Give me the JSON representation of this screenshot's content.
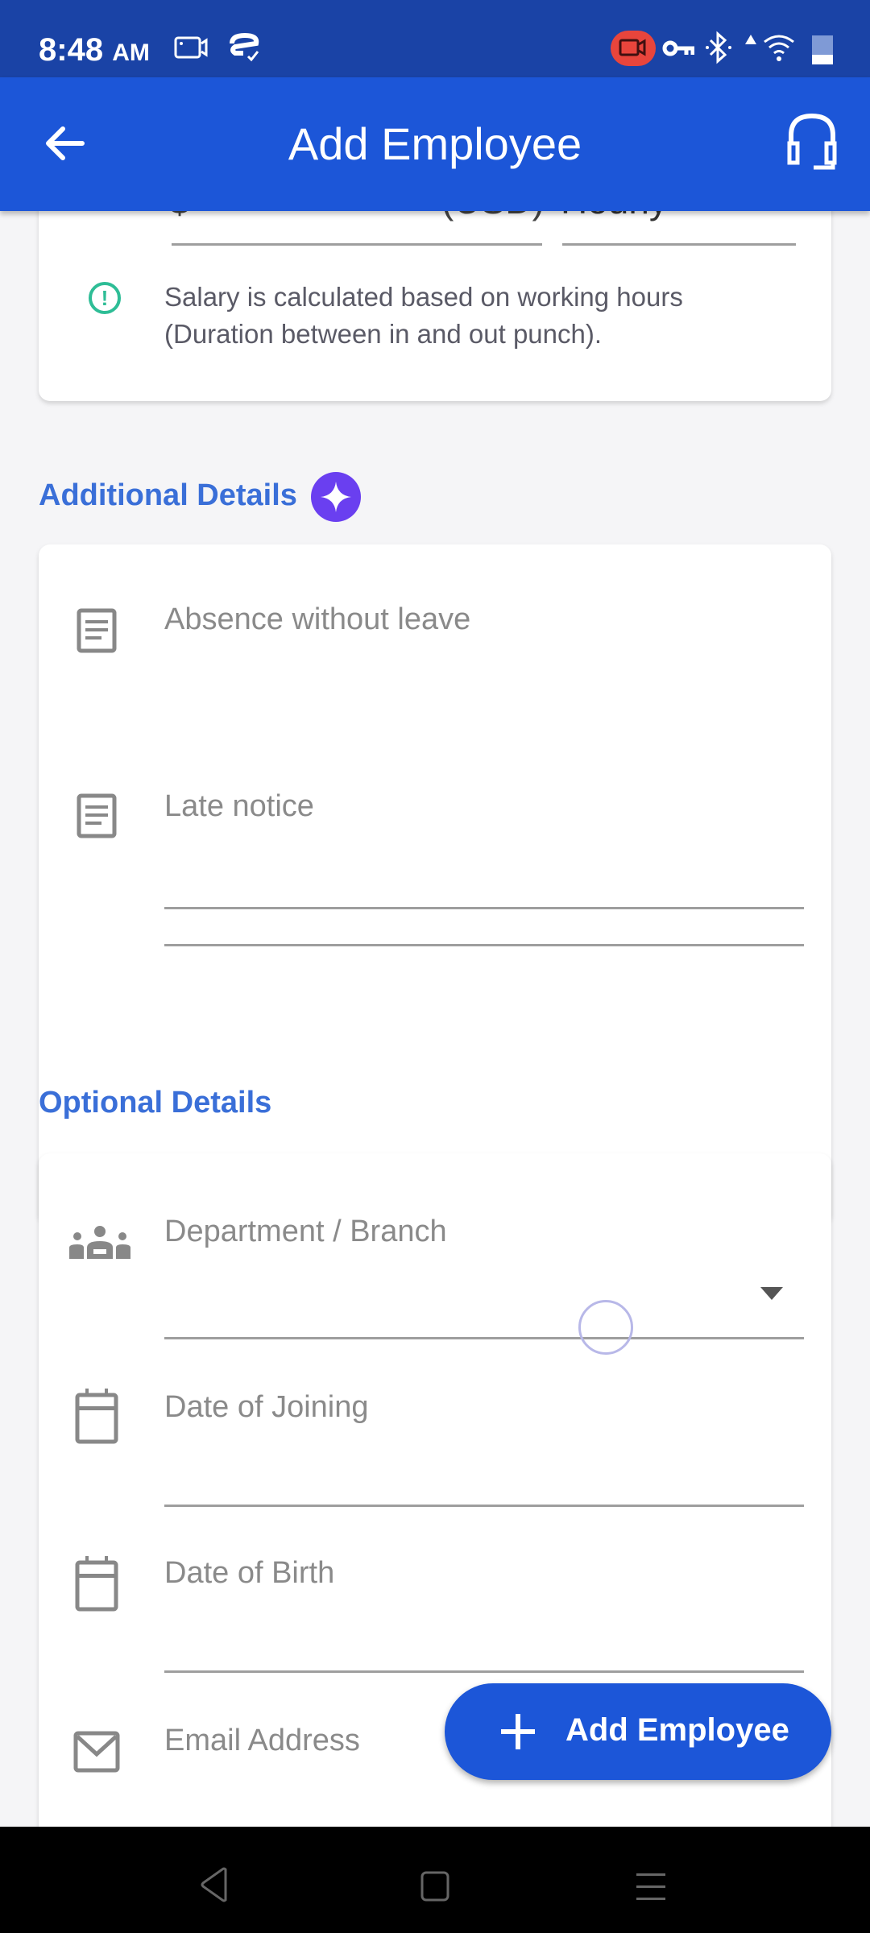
{
  "status_bar": {
    "time": "8:48",
    "ampm": "AM",
    "icons": [
      "screen-record-icon",
      "sync-check-icon",
      "recording-active-icon",
      "vpn-key-icon",
      "bluetooth-icon",
      "signal-icon",
      "wifi-icon",
      "battery-icon"
    ],
    "recording_badge_color": "#e8453c"
  },
  "app_bar": {
    "title": "Add Employee",
    "back_icon": "arrow-left-icon",
    "support_icon": "headset-icon",
    "color": "#1c56d8"
  },
  "salary_card": {
    "amount_prefix": "$",
    "currency": "(USD)",
    "frequency": "Hourly",
    "info_text_line1": "Salary is calculated based on working hours",
    "info_text_line2": "(Duration between in and out punch).",
    "info_icon_color": "#2ebd96"
  },
  "additional_details": {
    "title": "Additional Details",
    "badge_icon": "sparkle-icon",
    "badge_color": "#6a3ff0",
    "fields": [
      {
        "label": "Absence without leave",
        "icon": "notes-icon"
      },
      {
        "label": "Late notice",
        "icon": "notes-icon"
      }
    ]
  },
  "optional_details": {
    "title": "Optional Details",
    "fields": [
      {
        "label": "Department / Branch",
        "icon": "group-icon",
        "type": "dropdown"
      },
      {
        "label": "Date of Joining",
        "icon": "calendar-icon"
      },
      {
        "label": "Date of Birth",
        "icon": "calendar-icon"
      },
      {
        "label": "Email Address",
        "icon": "mail-icon"
      }
    ]
  },
  "fab": {
    "label": "Add Employee",
    "icon": "plus-icon"
  },
  "nav_bar": {
    "buttons": [
      "back",
      "home",
      "recents"
    ]
  }
}
